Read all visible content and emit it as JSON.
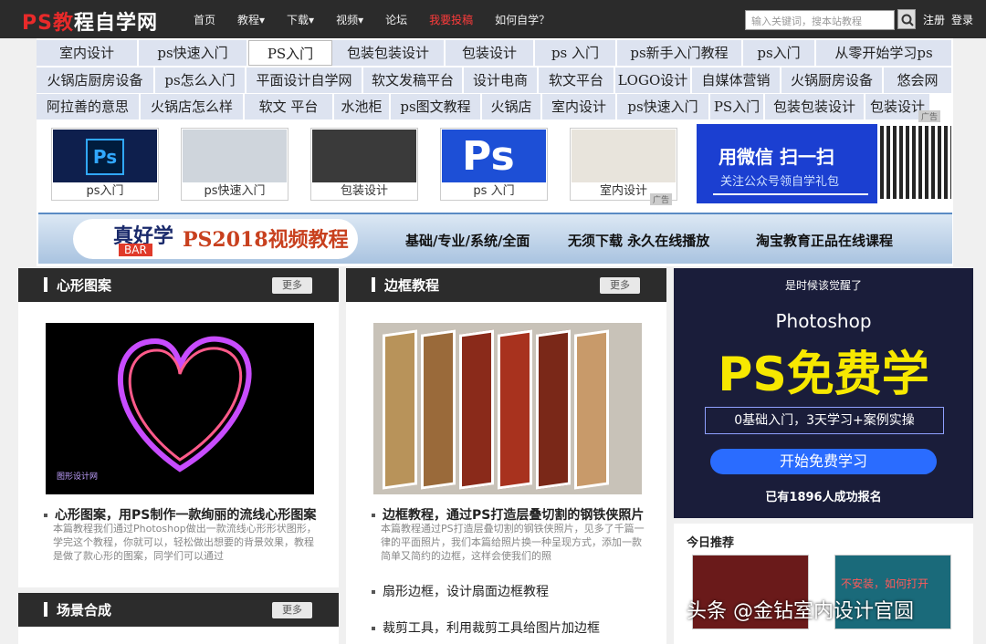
{
  "header": {
    "logo_ps": "PS",
    "logo_jc": "教",
    "logo_rest": "程自学网",
    "nav": [
      "首页",
      "教程▾",
      "下载▾",
      "视频▾",
      "论坛",
      "我要投稿",
      "如何自学？"
    ],
    "search_placeholder": "输入关键词，搜本站教程",
    "register": "注册",
    "login": "登录"
  },
  "tags": {
    "row1": [
      "室内设计",
      "ps快速入门",
      "PS入门",
      "包装包装设计",
      "包装设计",
      "ps 入门",
      "ps新手入门教程",
      "ps入门",
      "从零开始学习ps"
    ],
    "row2": [
      "火锅店厨房设备",
      "ps怎么入门",
      "平面设计自学网",
      "软文发稿平台",
      "设计电商",
      "软文平台",
      "LOGO设计",
      "自媒体营销",
      "火锅厨房设备",
      "悠会网"
    ],
    "row3": [
      "阿拉善的意思",
      "火锅店怎么样",
      "软文 平台",
      "水池柜",
      "ps图文教程",
      "火锅店",
      "室内设计",
      "ps快速入门",
      "PS入门",
      "包装包装设计",
      "包装设计"
    ]
  },
  "thumbs": [
    "ps入门",
    "ps快速入门",
    "包装设计",
    "ps 入门",
    "室内设计"
  ],
  "ad": {
    "line1": "用微信 扫一扫",
    "line2": "关注公众号领自学礼包",
    "tag": "广告",
    "tag2": "广告"
  },
  "banner": {
    "brand": "真好学",
    "bar": "BAR",
    "title": "PS2018视频教程",
    "f1": "基础/专业/系统/全面",
    "f2": "无须下载 永久在线播放",
    "f3": "淘宝教育正品在线课程"
  },
  "panel1": {
    "title": "心形图案",
    "more": "更多",
    "img_wm": "图形设计网",
    "a_title": "心形图案，用PS制作一款绚丽的流线心形图案",
    "a_desc": "本篇教程我们通过Photoshop做出一款流线心形形状图形，学完这个教程，你就可以，轻松做出想要的背景效果，教程是做了款心形的图案，同学们可以通过"
  },
  "panel2": {
    "title": "边框教程",
    "more": "更多",
    "a_title": "边框教程，通过PS打造层叠切割的钢铁侠照片",
    "a_desc": "本篇教程通过PS打造层叠切割的钢铁侠照片，见多了千篇一律的平面照片，我们本篇给照片换一种呈现方式，添加一款简单又简约的边框，这样会使我们的照",
    "list": [
      "扇形边框，设计扇面边框教程",
      "裁剪工具，利用裁剪工具给图片加边框"
    ]
  },
  "panel3": {
    "title": "场景合成",
    "more": "更多"
  },
  "promo": {
    "a": "是时候该觉醒了",
    "b": "Photoshop",
    "c": "PS免费学",
    "d": "0基础入门，3天学习+案例实操",
    "e": "开始免费学习",
    "f": "已有1896人成功报名"
  },
  "today": {
    "title": "今日推荐",
    "img2_text": "不安装，如何打开"
  },
  "watermark": "头条 @金钻室内设计官圆"
}
